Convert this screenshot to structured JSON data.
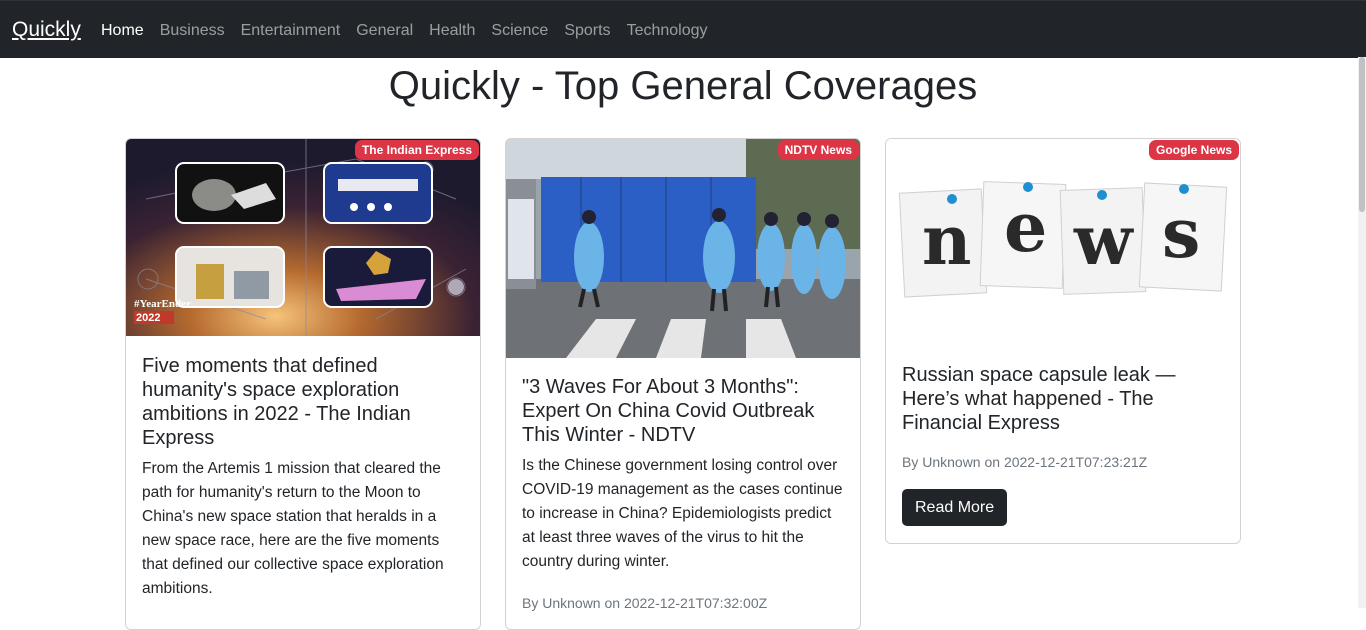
{
  "navbar": {
    "brand": "Quickly",
    "items": [
      {
        "label": "Home"
      },
      {
        "label": "Business"
      },
      {
        "label": "Entertainment"
      },
      {
        "label": "General"
      },
      {
        "label": "Health"
      },
      {
        "label": "Science"
      },
      {
        "label": "Sports"
      },
      {
        "label": "Technology"
      }
    ],
    "active": "Home"
  },
  "page_title": "Quickly - Top General Coverages",
  "cards": [
    {
      "source": "The Indian Express",
      "image_text": {
        "tag": "#YearEnder",
        "year": "2022"
      },
      "title": "Five moments that defined humanity's space exploration ambitions in 2022 - The Indian Express",
      "description": "From the Artemis 1 mission that cleared the path for humanity's return to the Moon to China's new space station that heralds in a new space race, here are the five moments that defined our collective space exploration ambitions."
    },
    {
      "source": "NDTV News",
      "title": "\"3 Waves For About 3 Months\": Expert On China Covid Outbreak This Winter - NDTV",
      "description": "Is the Chinese government losing control over COVID-19 management as the cases continue to increase in China? Epidemiologists predict at least three waves of the virus to hit the country during winter.",
      "meta": "By Unknown on 2022-12-21T07:32:00Z"
    },
    {
      "source": "Google News",
      "image_text": {
        "letters": [
          "n",
          "e",
          "w",
          "s"
        ]
      },
      "title": "Russian space capsule leak — Here’s what happened - The Financial Express",
      "meta": "By Unknown on 2022-12-21T07:23:21Z",
      "button": "Read More"
    }
  ],
  "colors": {
    "navbar": "#212529",
    "badge": "#dc3545",
    "button": "#212529"
  }
}
